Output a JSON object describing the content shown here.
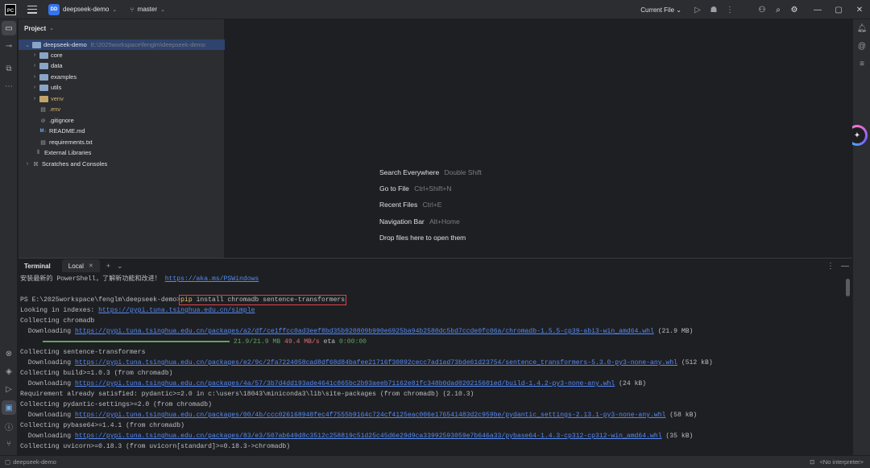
{
  "titlebar": {
    "logo_text": "PC",
    "project_badge": "DD",
    "project_name": "deepseek-demo",
    "branch": "master",
    "run_config": "Current File"
  },
  "project_panel": {
    "title": "Project",
    "root": {
      "name": "deepseek-demo",
      "path": "E:\\2025workspace\\fenglm\\deepseek-demo"
    },
    "items": [
      {
        "label": "core",
        "kind": "folder"
      },
      {
        "label": "data",
        "kind": "folder"
      },
      {
        "label": "examples",
        "kind": "folder"
      },
      {
        "label": "utils",
        "kind": "folder"
      },
      {
        "label": "venv",
        "kind": "folder-excluded"
      },
      {
        "label": ".env",
        "kind": "file"
      },
      {
        "label": ".gitignore",
        "kind": "file"
      },
      {
        "label": "README.md",
        "kind": "markdown",
        "icon_text": "M↓"
      },
      {
        "label": "requirements.txt",
        "kind": "file"
      }
    ],
    "external_libraries": "External Libraries",
    "scratches": "Scratches and Consoles"
  },
  "editor_hints": [
    {
      "label": "Search Everywhere",
      "key": "Double Shift"
    },
    {
      "label": "Go to File",
      "key": "Ctrl+Shift+N"
    },
    {
      "label": "Recent Files",
      "key": "Ctrl+E"
    },
    {
      "label": "Navigation Bar",
      "key": "Alt+Home"
    },
    {
      "label": "Drop files here to open them",
      "key": ""
    }
  ],
  "terminal": {
    "title": "Terminal",
    "tab": "Local",
    "lines": {
      "l0_text": "安装最新的 PowerShell，了解新功能和改进！",
      "l0_link": "https://aka.ms/PSWindows",
      "prompt": "PS E:\\2025workspace\\fenglm\\deepseek-demo>",
      "cmd_pip": "pip",
      "cmd_rest": " install chromadb sentence-transformers",
      "l3_text": "Looking in indexes: ",
      "l3_link": "https://pypi.tuna.tsinghua.edu.cn/simple",
      "l4": "Collecting chromadb",
      "l5_pre": "  Downloading ",
      "l5_link": "https://pypi.tuna.tsinghua.edu.cn/packages/a2/df/ce1ffcc0ad3eef8bd35b920809b990e6925ba94b2580dc5bd7ccde0fc06a/chromadb-1.5.5-cp39-abi3-win_amd64.whl",
      "l5_post": " (21.9 MB)",
      "l6_size": "21.9/21.9 MB",
      "l6_speed": "49.4 MB/s",
      "l6_eta_label": " eta ",
      "l6_eta": "0:00:00",
      "l7": "Collecting sentence-transformers",
      "l8_pre": "  Downloading ",
      "l8_link": "https://pypi.tuna.tsinghua.edu.cn/packages/e2/9c/2fa7224058cad8df68d84bafee21716f30892cecc7ad1ad73bde61d23754/sentence_transformers-5.3.0-py3-none-any.whl",
      "l8_post": " (512 kB)",
      "l9": "Collecting build>=1.0.3 (from chromadb)",
      "l10_pre": "  Downloading ",
      "l10_link": "https://pypi.tuna.tsinghua.edu.cn/packages/4a/57/3b7d4dd193ade4641c865bc2b93aeeb71162e81fc348b0dad020215601ed/build-1.4.2-py3-none-any.whl",
      "l10_post": " (24 kB)",
      "l11": "Requirement already satisfied: pydantic>=2.0 in c:\\users\\18043\\miniconda3\\lib\\site-packages (from chromadb) (2.10.3)",
      "l12": "Collecting pydantic-settings>=2.0 (from chromadb)",
      "l13_pre": "  Downloading ",
      "l13_link": "https://pypi.tuna.tsinghua.edu.cn/packages/00/4b/ccc026168948fec4f7555b9164c724cf4125eac006e176541483d2c959be/pydantic_settings-2.13.1-py3-none-any.whl",
      "l13_post": " (58 kB)",
      "l14": "Collecting pybase64>=1.4.1 (from chromadb)",
      "l15_pre": "  Downloading ",
      "l15_link": "https://pypi.tuna.tsinghua.edu.cn/packages/83/e3/507ab649d8c3512c258819c51d25c45d6e29d9ca33992593059e7b646a33/pybase64-1.4.3-cp312-cp312-win_amd64.whl",
      "l15_post": " (35 kB)",
      "l16": "Collecting uvicorn>=0.18.3 (from uvicorn[standard]>=0.18.3->chromadb)"
    },
    "download_progress": 1.0
  },
  "statusbar": {
    "project": "deepseek-demo",
    "interpreter": "<No interpreter>"
  },
  "icons": {
    "accent": "#3574f0",
    "selection": "#2e436e",
    "link": "#548af7",
    "progress": "#5ca55c",
    "highlight_box": "#e0434a"
  }
}
